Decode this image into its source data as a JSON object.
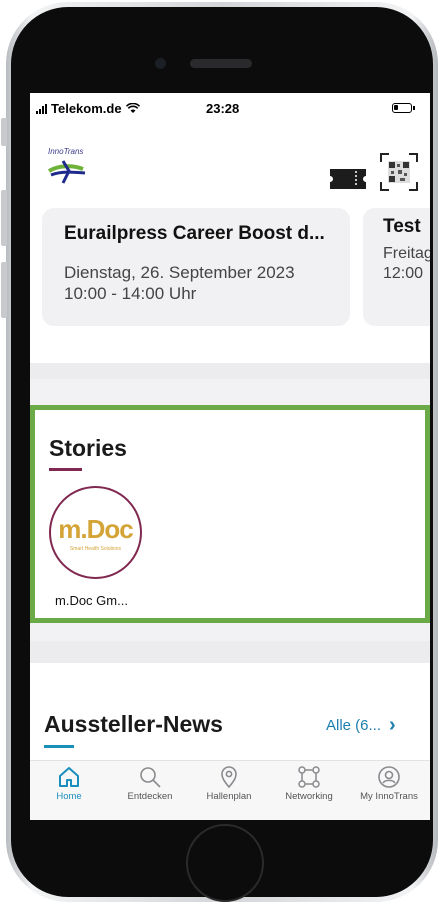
{
  "status_bar": {
    "carrier": "Telekom.de",
    "time": "23:28"
  },
  "header": {
    "logo_text": "InnoTrans",
    "ticket_icon": "ticket-icon",
    "qr_icon": "qr-code-icon"
  },
  "events": [
    {
      "title": "Eurailpress Career Boost d...",
      "date_line1": "Dienstag, 26. September 2023",
      "date_line2": "10:00 - 14:00 Uhr"
    },
    {
      "title": "Test",
      "date_line1": "Freitag",
      "date_line2": "12:00"
    }
  ],
  "stories": {
    "title": "Stories",
    "items": [
      {
        "logo_text": "m.Doc",
        "logo_sub": "Smart Health Solutions",
        "label": "m.Doc Gm..."
      }
    ]
  },
  "news": {
    "title": "Aussteller-News",
    "all_label": "Alle (6...",
    "all_chevron": "›"
  },
  "tabbar": {
    "items": [
      {
        "label": "Home",
        "icon": "home-icon",
        "active": true
      },
      {
        "label": "Entdecken",
        "icon": "search-icon",
        "active": false
      },
      {
        "label": "Hallenplan",
        "icon": "map-pin-icon",
        "active": false
      },
      {
        "label": "Networking",
        "icon": "network-icon",
        "active": false
      },
      {
        "label": "My InnoTrans",
        "icon": "user-icon",
        "active": false
      }
    ]
  },
  "colors": {
    "accent": "#1a8fbd",
    "highlight_border": "#6aab47",
    "stories_underline": "#80284f",
    "story_logo": "#d4a437"
  }
}
